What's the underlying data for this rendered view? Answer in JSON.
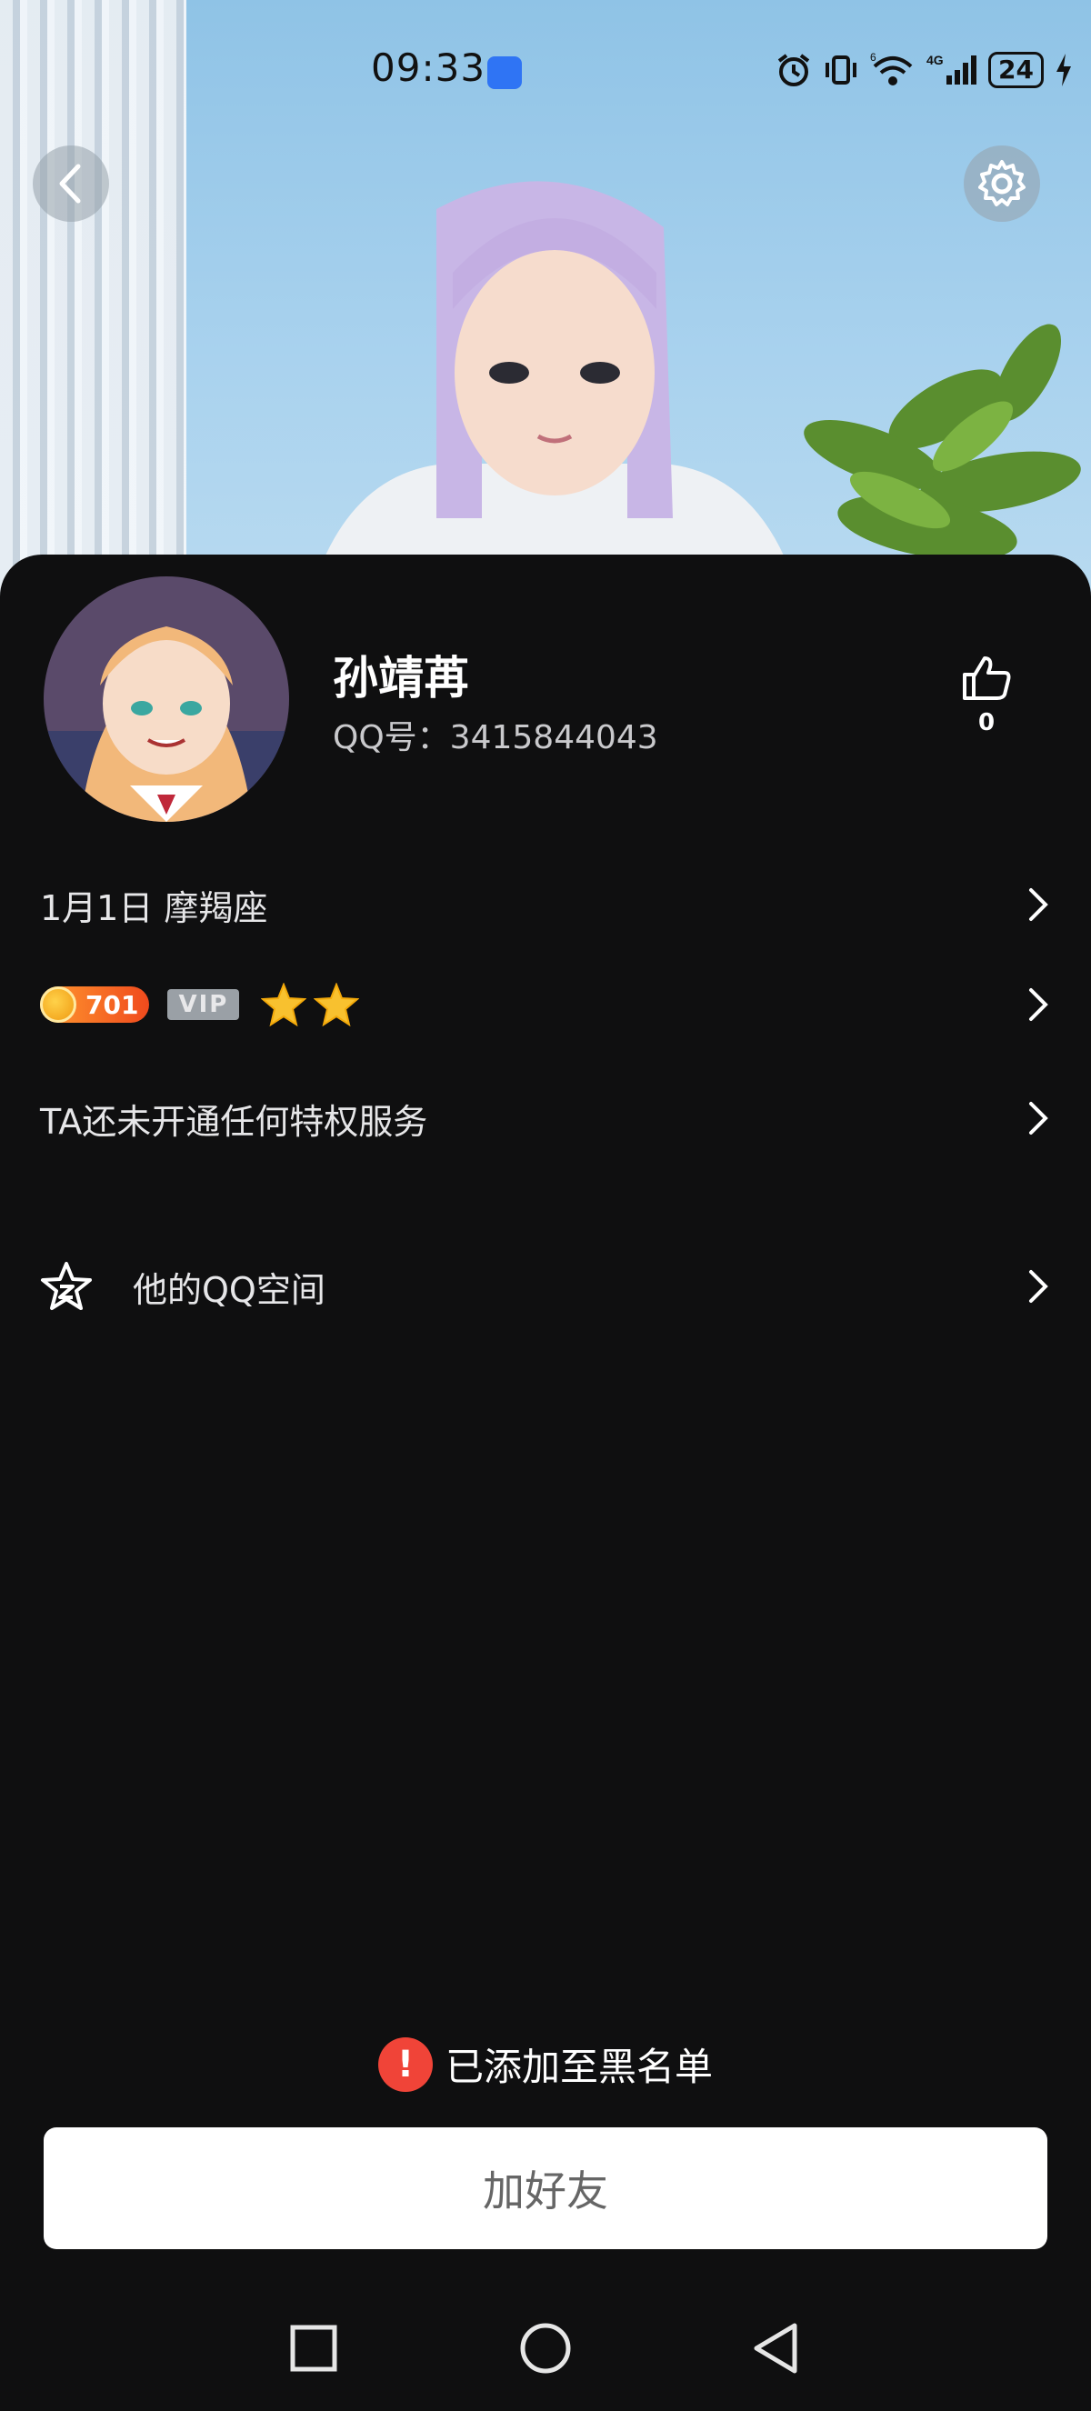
{
  "status_bar": {
    "time": "09:33",
    "network": "4G",
    "wifi_level": "6",
    "battery": "24"
  },
  "header": {
    "back_icon": "chevron-left-icon",
    "settings_icon": "gear-icon"
  },
  "profile": {
    "name": "孙靖苒",
    "qq_label": "QQ号：3415844043",
    "likes": "0"
  },
  "rows": {
    "birthday": "1月1日   摩羯座",
    "level": "701",
    "vip": "VIP",
    "privilege": "TA还未开通任何特权服务",
    "qzone": "他的QQ空间"
  },
  "footer": {
    "blacklist_notice": "已添加至黑名单",
    "add_friend": "加好友"
  },
  "colors": {
    "background": "#0f0f10",
    "warning": "#f04438",
    "level_badge": "#f04a1d"
  }
}
